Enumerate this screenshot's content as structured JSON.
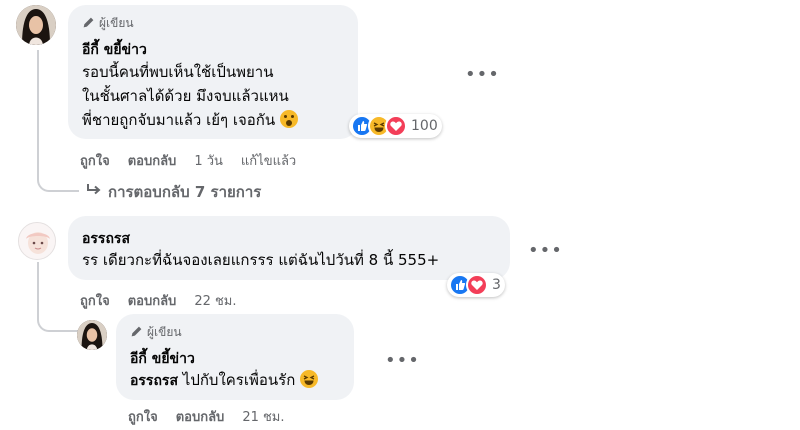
{
  "comments": [
    {
      "author_badge": "ผู้เขียน",
      "name": "อีกี้ ขยี้ข่าว",
      "lines": [
        "รอบนี้คนที่พบเห็นใช้เป็นพยาน",
        "ในชั้นศาลได้ด้วย มึงจบแล้วแหน",
        "พี่ชายถูกจับมาแล้ว เย้ๆ เจอกัน"
      ],
      "reaction_count": "100",
      "actions": {
        "like": "ถูกใจ",
        "reply": "ตอบกลับ",
        "time": "1 วัน",
        "edit": "แก้ไขแล้ว"
      },
      "replies_link": "การตอบกลับ 7 รายการ"
    },
    {
      "name": "อรรถรส",
      "text": "รร เดียวกะที่ฉันจองเลยแกรรร แต่ฉันไปวันที่ 8 นี้ 555+",
      "reaction_count": "3",
      "actions": {
        "like": "ถูกใจ",
        "reply": "ตอบกลับ",
        "time": "22 ชม."
      }
    },
    {
      "author_badge": "ผู้เขียน",
      "name": "อีกี้ ขยี้ข่าว",
      "mention": "อรรถรส",
      "text": "ไปกับใครเพื่อนรัก",
      "actions": {
        "like": "ถูกใจ",
        "reply": "ตอบกลับ",
        "time": "21 ชม."
      }
    }
  ],
  "colors": {
    "bubble": "#f0f2f5",
    "like": "#1877f2",
    "love": "#f33e58",
    "haha": "#f7b928",
    "meta": "#65676b"
  }
}
